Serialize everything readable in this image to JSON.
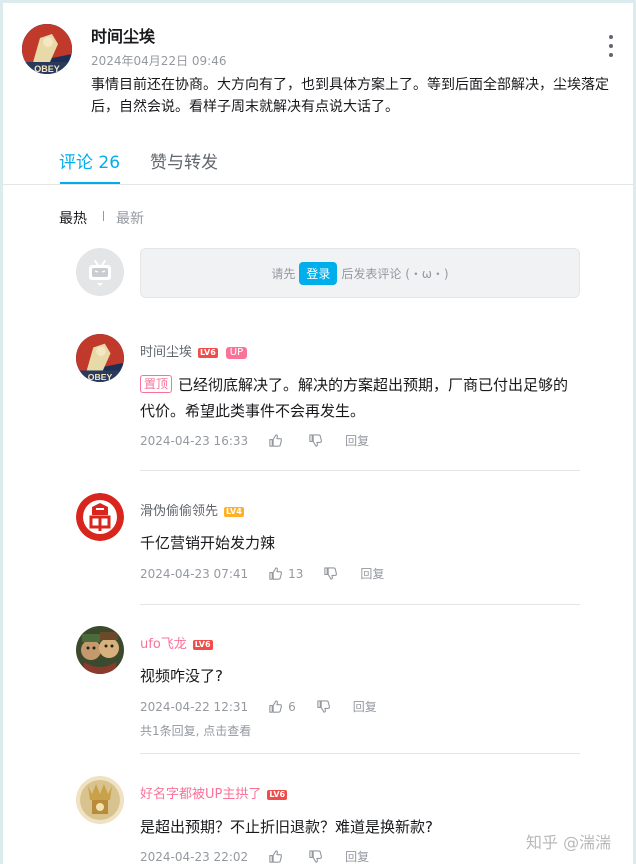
{
  "post": {
    "author": "时间尘埃",
    "time": "2024年04月22日 09:46",
    "content": "事情目前还在协商。大方向有了，也到具体方案上了。等到后面全部解决，尘埃落定后，自然会说。看样子周末就解决有点说大话了。",
    "more_icon": "more-vertical-icon"
  },
  "tabs": {
    "comments": "评论 26",
    "likes_reposts": "赞与转发"
  },
  "sort": {
    "hot": "最热",
    "new": "最新"
  },
  "comment_box": {
    "prefix": "请先",
    "login_label": "登录",
    "suffix": "后发表评论 (・ω・)"
  },
  "comments": [
    {
      "name": "时间尘埃",
      "level": "LV6",
      "badge": "UP",
      "pin": "置顶",
      "text": "已经彻底解决了。解决的方案超出预期，厂商已付出足够的代价。希望此类事件不会再发生。",
      "time": "2024-04-23 16:33",
      "likes": "",
      "reply": "回复"
    },
    {
      "name": "滑伪偷偷领先",
      "level": "LV4",
      "text": "千亿营销开始发力辣",
      "time": "2024-04-23 07:41",
      "likes": "13",
      "reply": "回复"
    },
    {
      "name": "ufo飞龙",
      "level": "LV6",
      "text": "视频咋没了?",
      "time": "2024-04-22 12:31",
      "likes": "6",
      "reply": "回复",
      "sub": "共1条回复, 点击查看"
    },
    {
      "name": "好名字都被UP主拱了",
      "level": "LV6",
      "text": "是超出预期？不止折旧退款？难道是换新款?",
      "time": "2024-04-23 22:02",
      "likes": "",
      "reply": "回复"
    }
  ],
  "watermark": "知乎 @湍湍",
  "colors": {
    "accent": "#00aeec",
    "pink": "#fb7299",
    "text": "#18191c",
    "muted": "#9499a0"
  }
}
